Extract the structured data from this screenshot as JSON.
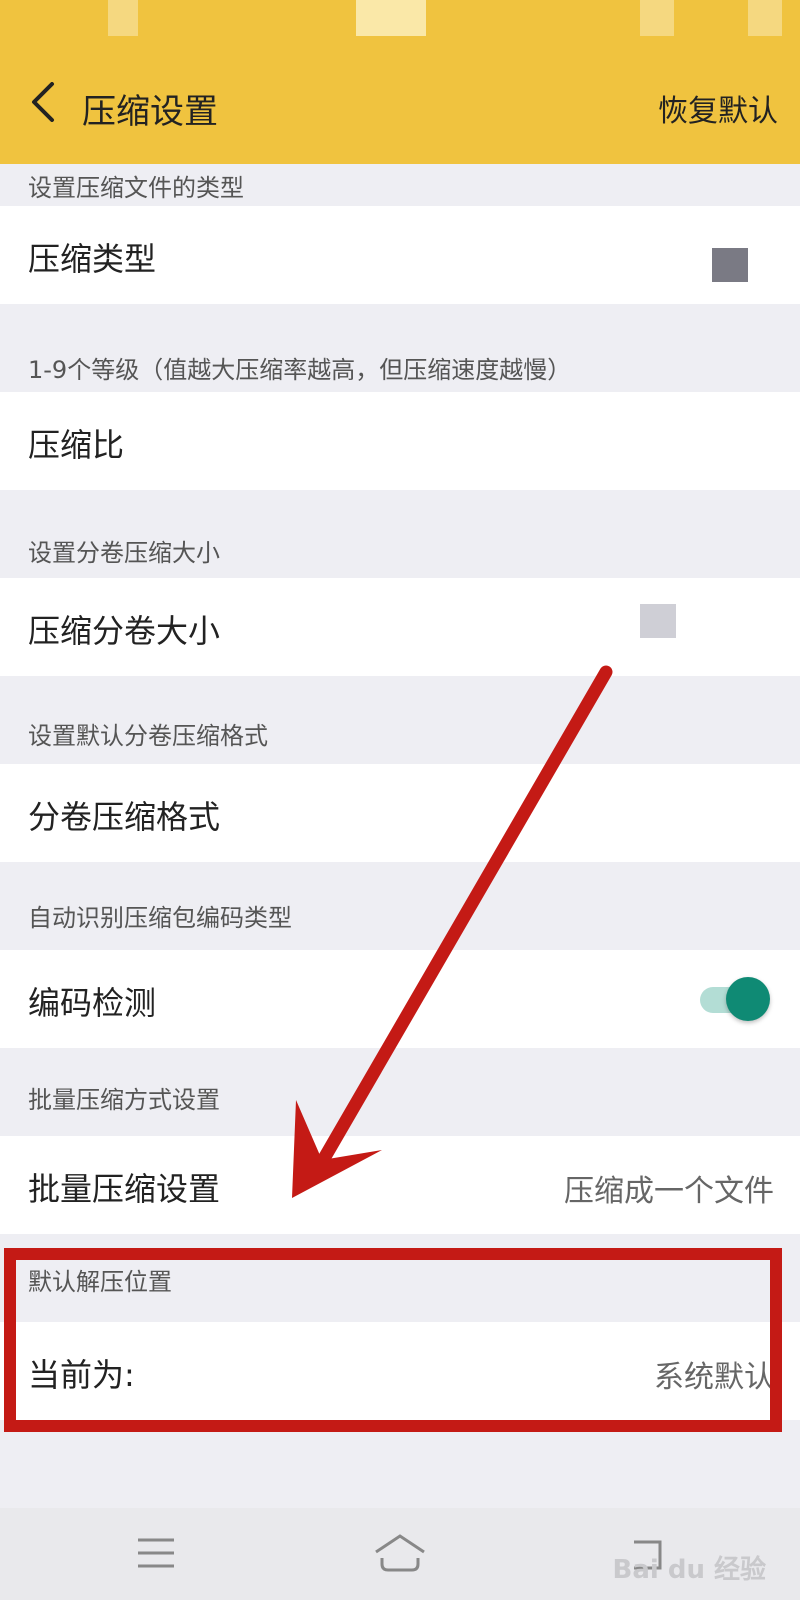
{
  "header": {
    "back_icon": "chevron-left-icon",
    "title": "压缩设置",
    "restore_label": "恢复默认"
  },
  "sections": [
    {
      "hint": "设置压缩文件的类型",
      "label": "压缩类型",
      "value": ""
    },
    {
      "hint": "1-9个等级（值越大压缩率越高，但压缩速度越慢）",
      "label": "压缩比",
      "value": ""
    },
    {
      "hint": "设置分卷压缩大小",
      "label": "压缩分卷大小",
      "value": ""
    },
    {
      "hint": "设置默认分卷压缩格式",
      "label": "分卷压缩格式",
      "value": ""
    },
    {
      "hint": "自动识别压缩包编码类型",
      "label": "编码检测",
      "toggle_on": true
    },
    {
      "hint": "批量压缩方式设置",
      "label": "批量压缩设置",
      "value": "压缩成一个文件"
    },
    {
      "hint": "默认解压位置",
      "label": "当前为:",
      "value": "系统默认"
    }
  ],
  "navbar": {
    "icons": [
      "menu-icon",
      "home-icon",
      "back-icon"
    ]
  },
  "watermark": {
    "text": "Bai du 经验"
  },
  "colors": {
    "accent": "#f0c33f",
    "toggle_on": "#0f8a74",
    "annotation_red": "#c41a15"
  }
}
